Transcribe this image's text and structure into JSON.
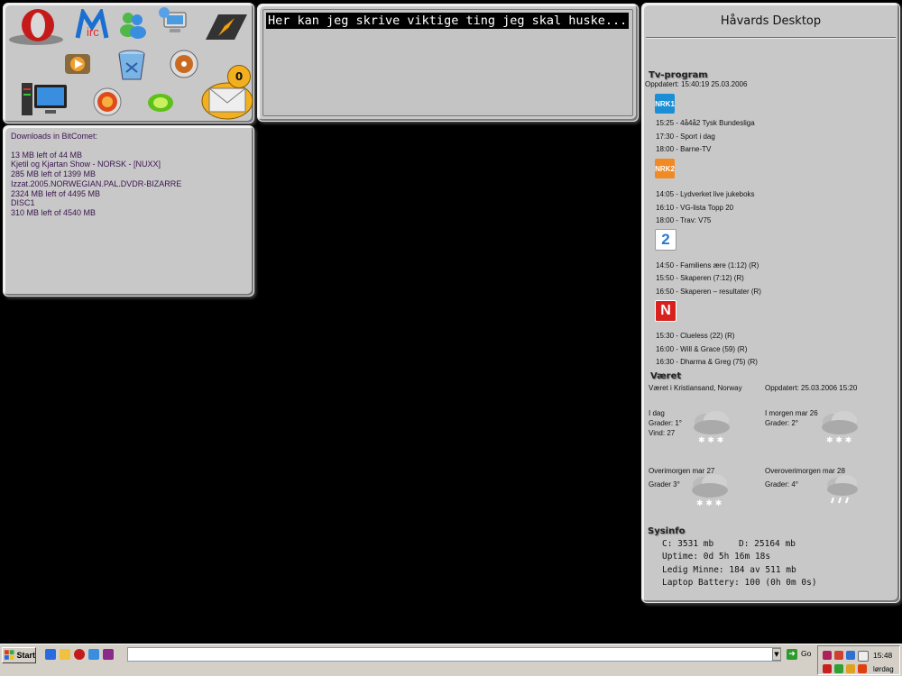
{
  "notes": {
    "text": "Her kan jeg skrive viktige ting jeg skal huske..."
  },
  "icons": [
    {
      "name": "opera-icon"
    },
    {
      "name": "mirc-icon"
    },
    {
      "name": "messenger-icon"
    },
    {
      "name": "network-icon"
    },
    {
      "name": "winamp-icon"
    },
    {
      "name": "media-player-icon"
    },
    {
      "name": "recycle-bin-icon"
    },
    {
      "name": "audio-icon"
    },
    {
      "name": "my-computer-icon"
    },
    {
      "name": "firefox-icon"
    },
    {
      "name": "limewire-icon"
    },
    {
      "name": "mail-icon"
    }
  ],
  "mail_badge": "0",
  "downloads": {
    "header": "Downloads in BitComet:",
    "lines": [
      "13 MB left of 44 MB",
      "Kjetil og Kjartan Show - NORSK - [NUXX]",
      "285 MB left of 1399 MB",
      "Izzat.2005.NORWEGIAN.PAL.DVDR-BIZARRE",
      "2324 MB left of 4495 MB",
      "DISC1",
      "310 MB left of 4540 MB"
    ]
  },
  "desktop": {
    "title": "Håvards Desktop",
    "tv": {
      "heading": "Tv-program",
      "updated": "Oppdatert: 15:40:19 25.03.2006",
      "channels": [
        {
          "logo": "NRK1",
          "color": "#1b8fd6",
          "shows": [
            "15:25 - 4å4å2 Tysk Bundesliga",
            "17:30 - Sport i dag",
            "18:00 - Barne-TV"
          ]
        },
        {
          "logo": "NRK2",
          "color": "#f08a25",
          "shows": [
            "14:05 - Lydverket live jukeboks",
            "16:10 - VG-lista Topp 20",
            "18:00 - Trav: V75"
          ]
        },
        {
          "logo": "2",
          "color": "#ffffff",
          "shows": [
            "14:50 - Familiens ære (1:12) (R)",
            "15:50 - Skaperen (7:12) (R)",
            "16:50 - Skaperen – resultater (R)"
          ]
        },
        {
          "logo": "N",
          "color": "#d8201e",
          "shows": [
            "15:30 - Clueless (22) (R)",
            "16:00 - Will & Grace (59) (R)",
            "16:30 - Dharma & Greg (75) (R)"
          ]
        }
      ]
    },
    "weather": {
      "heading": "Været",
      "location": "Været i Kristiansand, Norway",
      "updated": "Oppdatert: 25.03.2006 15:20",
      "days": [
        {
          "title": "I dag",
          "deg": "Grader: 1°",
          "wind": "Vind: 27",
          "icon": "snow-cloud-icon"
        },
        {
          "title": "I morgen mar 26",
          "deg": "Grader: 2°",
          "wind": "",
          "icon": "snow-cloud-icon"
        },
        {
          "title": "Overimorgen mar 27",
          "deg": "Grader 3°",
          "wind": "",
          "icon": "snow-cloud-icon"
        },
        {
          "title": "Overoverimorgen mar 28",
          "deg": "Grader: 4°",
          "wind": "",
          "icon": "rain-cloud-icon"
        }
      ]
    },
    "sysinfo": {
      "heading": "Sysinfo",
      "c": "C: 3531 mb",
      "d": "D: 25164 mb",
      "uptime": "Uptime: 0d 5h 16m 18s",
      "mem": "Ledig Minne: 184 av 511 mb",
      "battery": "Laptop Battery: 100 (0h 0m 0s)"
    }
  },
  "taskbar": {
    "start": "Start",
    "address_value": "",
    "go": "Go",
    "time": "15:48",
    "day": "lørdag"
  },
  "colors": {
    "panel": "#c8c8c8",
    "desktop": "#000000",
    "download_text": "#3a1550"
  }
}
